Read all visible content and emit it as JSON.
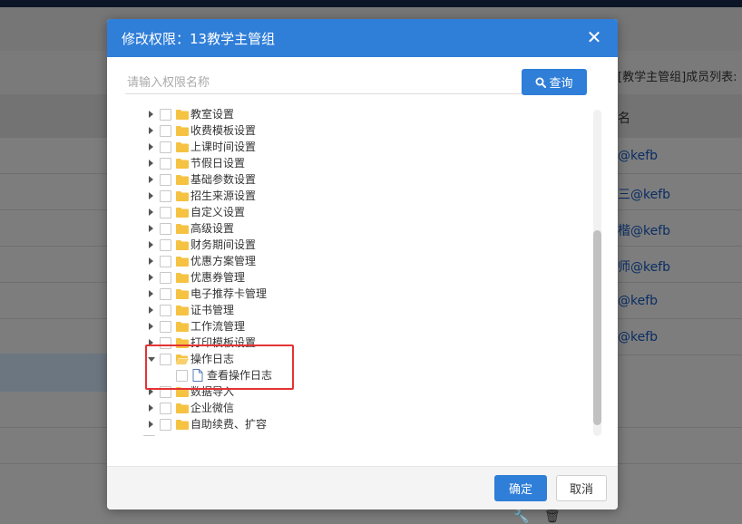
{
  "background": {
    "group_members_title": "[教学主管组]成员列表:",
    "column_header": "名",
    "members": [
      "@kefb",
      "三@kefb",
      "楷@kefb",
      "师@kefb",
      "@kefb",
      "@kefb"
    ]
  },
  "modal": {
    "title": "修改权限：13教学主管组",
    "search": {
      "placeholder": "请输入权限名称",
      "value": "",
      "button_label": "查询"
    },
    "tree": [
      {
        "label": "教室设置",
        "expanded": false
      },
      {
        "label": "收费模板设置",
        "expanded": false
      },
      {
        "label": "上课时间设置",
        "expanded": false
      },
      {
        "label": "节假日设置",
        "expanded": false
      },
      {
        "label": "基础参数设置",
        "expanded": false
      },
      {
        "label": "招生来源设置",
        "expanded": false
      },
      {
        "label": "自定义设置",
        "expanded": false
      },
      {
        "label": "高级设置",
        "expanded": false
      },
      {
        "label": "财务期间设置",
        "expanded": false
      },
      {
        "label": "优惠方案管理",
        "expanded": false
      },
      {
        "label": "优惠券管理",
        "expanded": false
      },
      {
        "label": "电子推荐卡管理",
        "expanded": false
      },
      {
        "label": "证书管理",
        "expanded": false
      },
      {
        "label": "工作流管理",
        "expanded": false
      },
      {
        "label": "打印模板设置",
        "expanded": false
      },
      {
        "label": "操作日志",
        "expanded": true,
        "children": [
          {
            "label": "查看操作日志"
          }
        ]
      },
      {
        "label": "数据导入",
        "expanded": false
      },
      {
        "label": "企业微信",
        "expanded": false
      },
      {
        "label": "自助续费、扩容",
        "expanded": false
      },
      {
        "label": "",
        "expanded": false
      }
    ],
    "ok_label": "确定",
    "cancel_label": "取消"
  },
  "colors": {
    "primary": "#2f7ed8",
    "highlight": "#e53333",
    "folder": "#f5c242"
  }
}
